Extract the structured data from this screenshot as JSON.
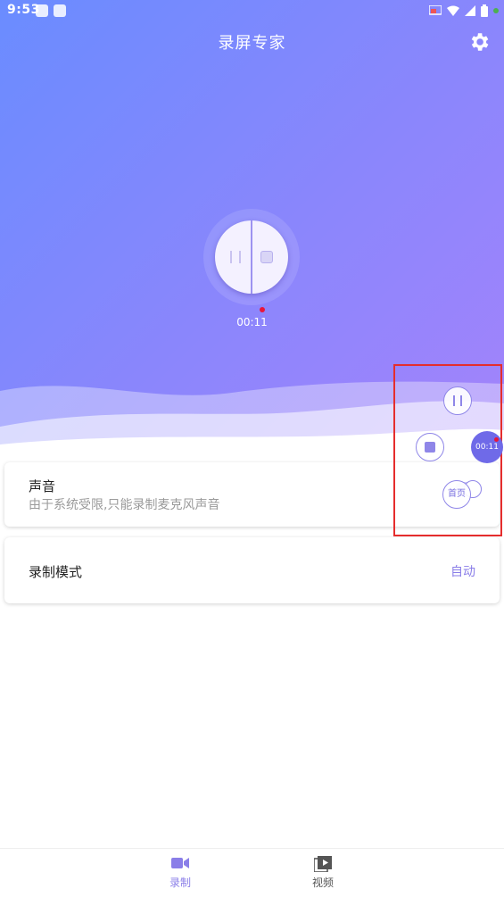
{
  "status_bar": {
    "time": "9:53"
  },
  "header": {
    "title": "录屏专家",
    "settings_icon": "gear-icon"
  },
  "recorder": {
    "elapsed": "00:11",
    "pause_icon": "pause-icon",
    "stop_icon": "stop-icon",
    "indicator_color": "#e8163a"
  },
  "sound_card": {
    "title": "声音",
    "description": "由于系统受限,只能录制麦克风声音"
  },
  "mode_card": {
    "title": "录制模式",
    "value": "自动"
  },
  "floating_controls": {
    "elapsed": "00:11",
    "home_label": "首页"
  },
  "bottom_nav": {
    "items": [
      {
        "label": "录制",
        "icon": "video-camera-icon",
        "active": true
      },
      {
        "label": "视频",
        "icon": "video-library-icon",
        "active": false
      }
    ]
  },
  "colors": {
    "accent": "#8a7ee8",
    "gradient_start": "#6a8cff",
    "gradient_end": "#a483fb",
    "highlight_box": "#e52d2d"
  }
}
